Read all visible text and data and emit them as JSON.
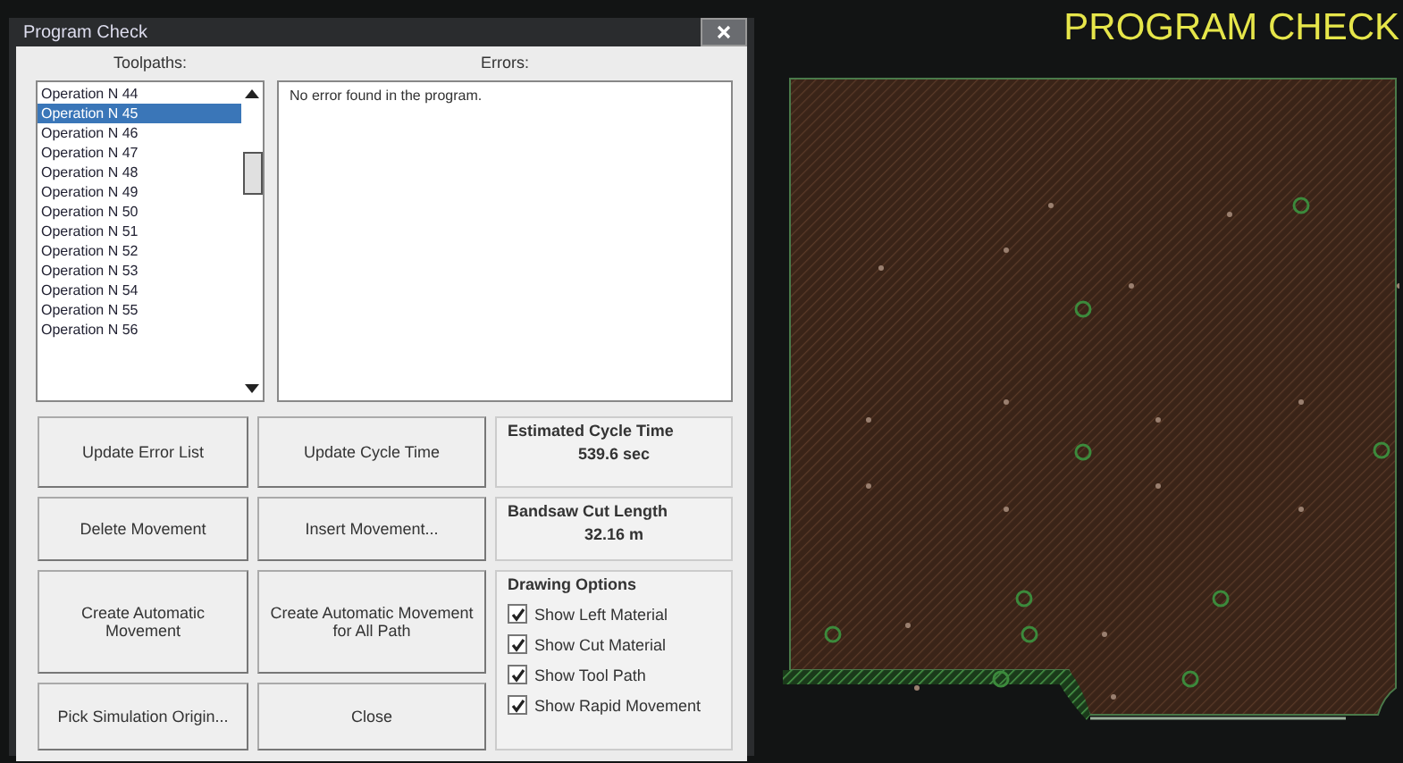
{
  "window": {
    "title": "Program Check"
  },
  "toolpaths": {
    "label": "Toolpaths:",
    "items": [
      {
        "label": "Operation N 44",
        "selected": false
      },
      {
        "label": "Operation N 45",
        "selected": true
      },
      {
        "label": "Operation N 46",
        "selected": false
      },
      {
        "label": "Operation N 47",
        "selected": false
      },
      {
        "label": "Operation N 48",
        "selected": false
      },
      {
        "label": "Operation N 49",
        "selected": false
      },
      {
        "label": "Operation N 50",
        "selected": false
      },
      {
        "label": "Operation N 51",
        "selected": false
      },
      {
        "label": "Operation N 52",
        "selected": false
      },
      {
        "label": "Operation N 53",
        "selected": false
      },
      {
        "label": "Operation N 54",
        "selected": false
      },
      {
        "label": "Operation N 55",
        "selected": false
      },
      {
        "label": "Operation N 56",
        "selected": false
      }
    ]
  },
  "errors": {
    "label": "Errors:",
    "items": [
      "No error found in the program."
    ]
  },
  "buttons": [
    [
      "Update Error List",
      "Update Cycle Time"
    ],
    [
      "Delete Movement",
      "Insert Movement..."
    ],
    [
      "Create Automatic Movement",
      "Create Automatic Movement for All Path"
    ],
    [
      "Pick Simulation Origin...",
      "Close"
    ]
  ],
  "estimated_cycle_time": {
    "label": "Estimated Cycle Time",
    "value": "539.6 sec"
  },
  "bandsaw_cut_length": {
    "label": "Bandsaw Cut Length",
    "value": "32.16 m"
  },
  "drawing_options": {
    "label": "Drawing Options",
    "items": [
      {
        "label": "Show Left Material",
        "checked": true
      },
      {
        "label": "Show Cut Material",
        "checked": true
      },
      {
        "label": "Show Tool Path",
        "checked": true
      },
      {
        "label": "Show Rapid Movement",
        "checked": true
      }
    ]
  },
  "view": {
    "title": "PROGRAM CHECK"
  }
}
